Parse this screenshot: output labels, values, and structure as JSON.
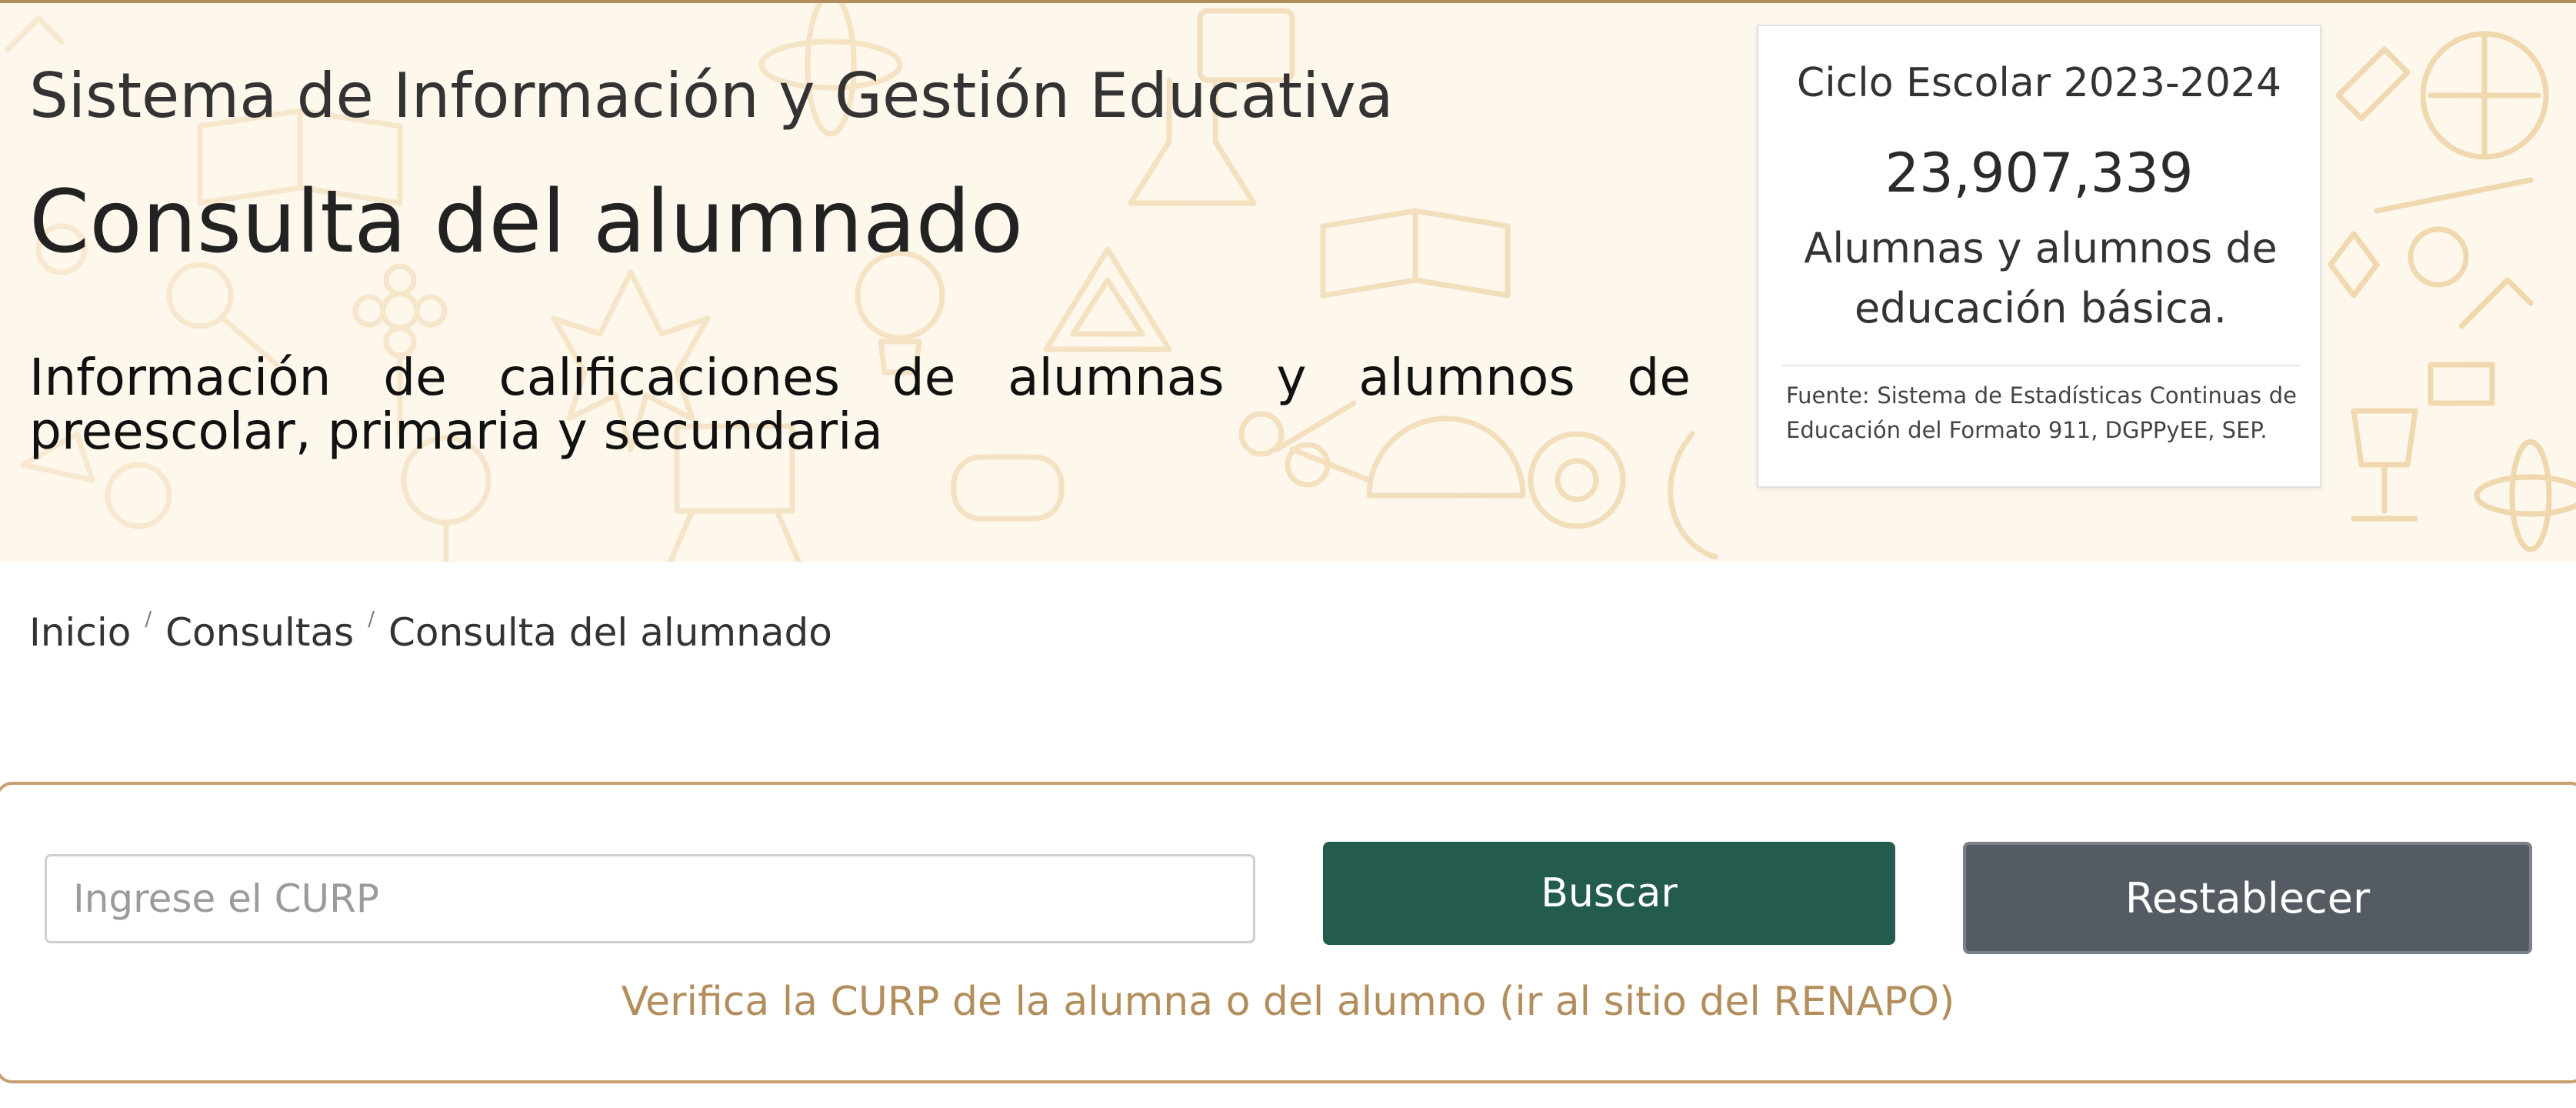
{
  "header": {
    "system_title": "Sistema de Información y Gestión Educativa",
    "page_title": "Consulta del alumnado",
    "subtitle": "Información de calificaciones de alumnas y alumnos de preescolar, primaria y secundaria"
  },
  "stats": {
    "cycle": "Ciclo Escolar 2023-2024",
    "total": "23,907,339",
    "description": "Alumnas y alumnos de educación básica.",
    "source": "Fuente: Sistema de Estadísticas Continuas de Educación del Formato 911, DGPPyEE, SEP."
  },
  "breadcrumb": {
    "separator": "/",
    "items": [
      "Inicio",
      "Consultas",
      "Consulta del alumnado"
    ]
  },
  "search": {
    "placeholder": "Ingrese el CURP",
    "value": "",
    "search_label": "Buscar",
    "reset_label": "Restablecer",
    "renapo_link": "Verifica la CURP de la alumna o del alumno (ir al sitio del RENAPO)"
  },
  "colors": {
    "primary_green": "#235b4e",
    "reset_gray": "#545b62",
    "gold_accent": "#b38e5d",
    "banner_bg": "#fdf7ec",
    "doodle": "#f0d7ad"
  }
}
